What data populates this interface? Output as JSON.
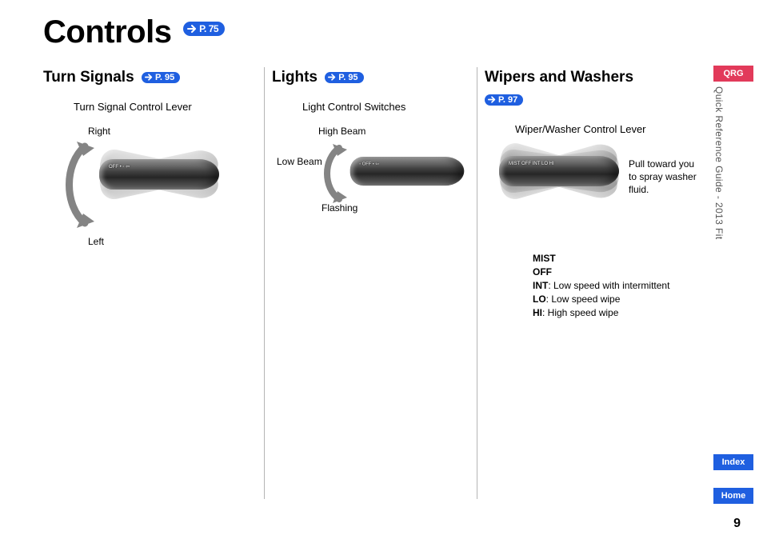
{
  "title": "Controls",
  "title_ref": "P. 75",
  "sections": {
    "turn": {
      "heading": "Turn Signals",
      "ref": "P. 95",
      "subtitle": "Turn Signal Control Lever",
      "labels": {
        "top": "Right",
        "bottom": "Left"
      }
    },
    "lights": {
      "heading": "Lights",
      "ref": "P. 95",
      "subtitle": "Light Control Switches",
      "labels": {
        "top": "High Beam",
        "mid": "Low Beam",
        "bottom": "Flashing"
      }
    },
    "wipers": {
      "heading": "Wipers and Washers",
      "ref": "P. 97",
      "subtitle": "Wiper/Washer Control Lever",
      "spray_note": "Pull toward you to spray washer fluid.",
      "modes": [
        {
          "key": "MIST",
          "desc": ""
        },
        {
          "key": "OFF",
          "desc": ""
        },
        {
          "key": "INT",
          "desc": ": Low speed with intermittent"
        },
        {
          "key": "LO",
          "desc": ": Low speed wipe"
        },
        {
          "key": "HI",
          "desc": ": High speed wipe"
        }
      ]
    }
  },
  "side": {
    "qrg": "QRG",
    "guide": "Quick Reference Guide - 2013 Fit",
    "index": "Index",
    "home": "Home"
  },
  "page_number": "9"
}
